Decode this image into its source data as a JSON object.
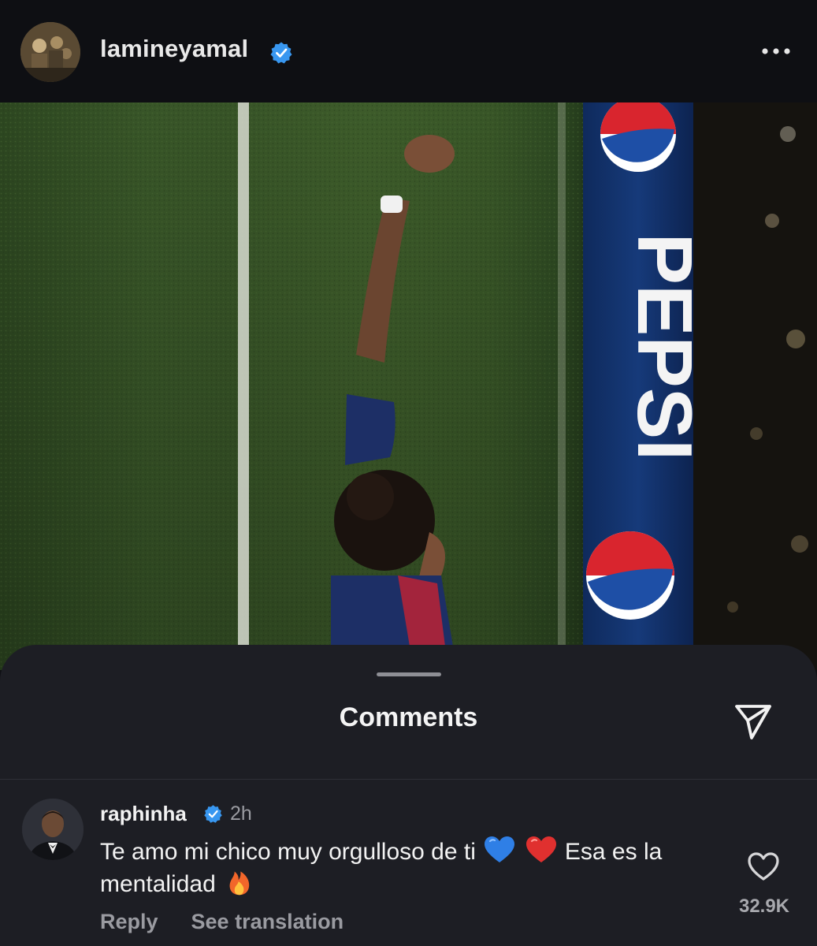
{
  "post": {
    "username": "lamineyamal",
    "verified": true,
    "more_icon": "more-horizontal-icon",
    "photo": {
      "banner_text": "PEPSI"
    }
  },
  "comments_sheet": {
    "title": "Comments",
    "share_icon": "send-icon",
    "comment": {
      "username": "raphinha",
      "verified": true,
      "time": "2h",
      "text_part1": "Te amo mi chico muy orgulloso de ti",
      "emoji_1": "blue-heart-emoji",
      "emoji_2": "red-heart-emoji",
      "text_part2": "Esa es la mentalidad",
      "emoji_3": "fire-emoji",
      "like_icon": "heart-outline-icon",
      "like_count": "32.9K",
      "reply_label": "Reply",
      "translate_label": "See translation"
    }
  },
  "colors": {
    "background": "#0f1014",
    "sheet": "#1d1e24",
    "verified_badge": "#3897f0",
    "secondary_text": "#9a9ba1"
  }
}
